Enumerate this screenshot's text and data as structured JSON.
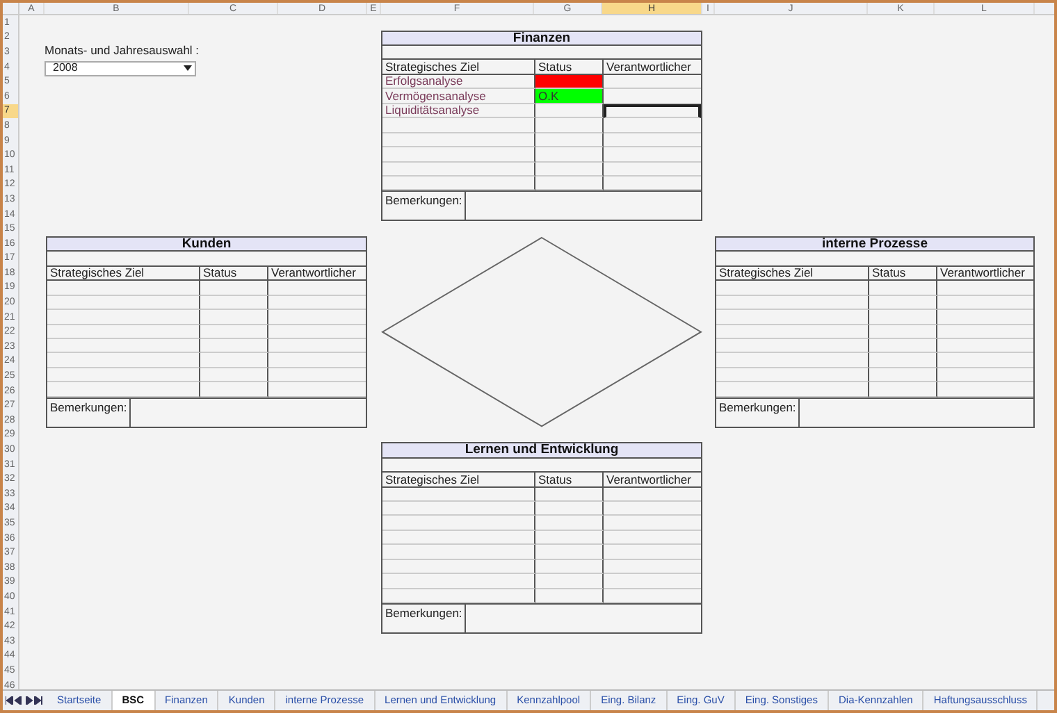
{
  "column_headers": [
    {
      "label": "A",
      "selected": false
    },
    {
      "label": "B",
      "selected": false
    },
    {
      "label": "C",
      "selected": false
    },
    {
      "label": "D",
      "selected": false
    },
    {
      "label": "E",
      "selected": false
    },
    {
      "label": "F",
      "selected": false
    },
    {
      "label": "G",
      "selected": false
    },
    {
      "label": "H",
      "selected": true
    },
    {
      "label": "I",
      "selected": false
    },
    {
      "label": "J",
      "selected": false
    },
    {
      "label": "K",
      "selected": false
    },
    {
      "label": "L",
      "selected": false
    }
  ],
  "row_headers": [
    {
      "label": "1",
      "selected": false
    },
    {
      "label": "2",
      "selected": false
    },
    {
      "label": "3",
      "selected": false
    },
    {
      "label": "4",
      "selected": false
    },
    {
      "label": "5",
      "selected": false
    },
    {
      "label": "6",
      "selected": false
    },
    {
      "label": "7",
      "selected": true
    },
    {
      "label": "8",
      "selected": false
    },
    {
      "label": "9",
      "selected": false
    },
    {
      "label": "10",
      "selected": false
    },
    {
      "label": "11",
      "selected": false
    },
    {
      "label": "12",
      "selected": false
    },
    {
      "label": "13",
      "selected": false
    },
    {
      "label": "14",
      "selected": false
    },
    {
      "label": "15",
      "selected": false
    },
    {
      "label": "16",
      "selected": false
    },
    {
      "label": "17",
      "selected": false
    },
    {
      "label": "18",
      "selected": false
    },
    {
      "label": "19",
      "selected": false
    },
    {
      "label": "20",
      "selected": false
    },
    {
      "label": "21",
      "selected": false
    },
    {
      "label": "22",
      "selected": false
    },
    {
      "label": "23",
      "selected": false
    },
    {
      "label": "24",
      "selected": false
    },
    {
      "label": "25",
      "selected": false
    },
    {
      "label": "26",
      "selected": false
    },
    {
      "label": "27",
      "selected": false
    },
    {
      "label": "28",
      "selected": false
    },
    {
      "label": "29",
      "selected": false
    },
    {
      "label": "30",
      "selected": false
    },
    {
      "label": "31",
      "selected": false
    },
    {
      "label": "32",
      "selected": false
    },
    {
      "label": "33",
      "selected": false
    },
    {
      "label": "34",
      "selected": false
    },
    {
      "label": "35",
      "selected": false
    },
    {
      "label": "36",
      "selected": false
    },
    {
      "label": "37",
      "selected": false
    },
    {
      "label": "38",
      "selected": false
    },
    {
      "label": "39",
      "selected": false
    },
    {
      "label": "40",
      "selected": false
    },
    {
      "label": "41",
      "selected": false
    },
    {
      "label": "42",
      "selected": false
    },
    {
      "label": "43",
      "selected": false
    },
    {
      "label": "44",
      "selected": false
    },
    {
      "label": "45",
      "selected": false
    },
    {
      "label": "46",
      "selected": false
    }
  ],
  "period_selector": {
    "label": "Monats- und Jahresauswahl :",
    "value": "2008"
  },
  "panels": [
    {
      "title": "Finanzen",
      "columns": [
        "Strategisches Ziel",
        "Status",
        "Verantwortlicher"
      ],
      "rows": [
        {
          "goal": "Erfolgsanalyse",
          "color": "#ff0000",
          "selected": false
        },
        {
          "goal": "Vermögensanalyse",
          "status": "O.K",
          "color": "#00ff00",
          "selected": false
        },
        {
          "goal": "Liquiditätsanalyse",
          "selected": true
        }
      ],
      "remarks_label": "Bemerkungen:"
    },
    {
      "title": "Kunden",
      "columns": [
        "Strategisches Ziel",
        "Status",
        "Verantwortlicher"
      ],
      "remarks_label": "Bemerkungen:"
    },
    {
      "title": "interne Prozesse",
      "columns": [
        "Strategisches Ziel",
        "Status",
        "Verantwortlicher"
      ],
      "remarks_label": "Bemerkungen:"
    },
    {
      "title": "Lernen und Entwicklung",
      "columns": [
        "Strategisches Ziel",
        "Status",
        "Verantwortlicher"
      ],
      "remarks_label": "Bemerkungen:"
    }
  ],
  "sheet_tabs": [
    {
      "label": "Startseite",
      "selected": false
    },
    {
      "label": "BSC",
      "selected": true
    },
    {
      "label": "Finanzen",
      "selected": false
    },
    {
      "label": "Kunden",
      "selected": false
    },
    {
      "label": "interne Prozesse",
      "selected": false
    },
    {
      "label": "Lernen und Entwicklung",
      "selected": false
    },
    {
      "label": "Kennzahlpool",
      "selected": false
    },
    {
      "label": "Eing. Bilanz",
      "selected": false
    },
    {
      "label": "Eing. GuV",
      "selected": false
    },
    {
      "label": "Eing. Sonstiges",
      "selected": false
    },
    {
      "label": "Dia-Kennzahlen",
      "selected": false
    },
    {
      "label": "Haftungsausschluss",
      "selected": false
    }
  ]
}
